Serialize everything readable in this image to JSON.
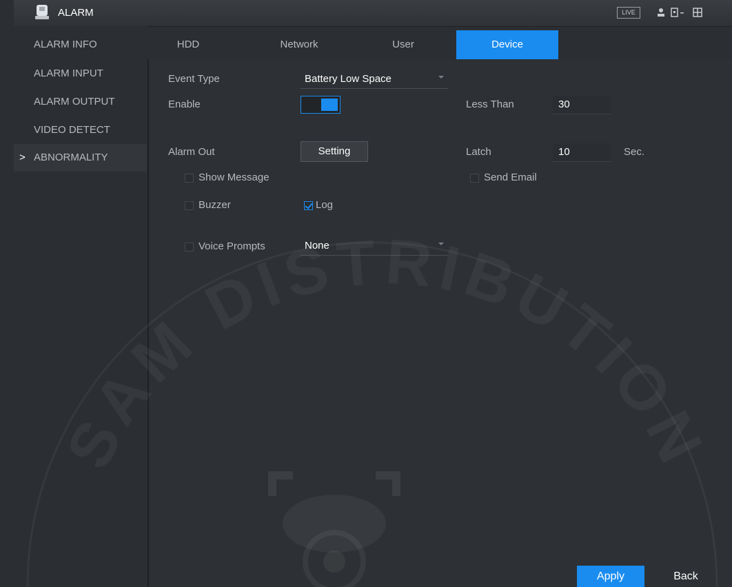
{
  "header": {
    "title": "ALARM",
    "live_badge": "LIVE"
  },
  "sidebar": {
    "items": [
      {
        "label": "ALARM INFO"
      },
      {
        "label": "ALARM INPUT"
      },
      {
        "label": "ALARM OUTPUT"
      },
      {
        "label": "VIDEO DETECT"
      },
      {
        "label": "ABNORMALITY",
        "chevron": ">"
      }
    ]
  },
  "tabs": [
    {
      "label": "HDD"
    },
    {
      "label": "Network"
    },
    {
      "label": "User"
    },
    {
      "label": "Device"
    }
  ],
  "form": {
    "event_type_label": "Event Type",
    "event_type_value": "Battery Low Space",
    "enable_label": "Enable",
    "less_than_label": "Less Than",
    "less_than_value": "30",
    "alarm_out_label": "Alarm Out",
    "setting_button": "Setting",
    "latch_label": "Latch",
    "latch_value": "10",
    "latch_unit": "Sec.",
    "show_message_label": "Show Message",
    "send_email_label": "Send Email",
    "buzzer_label": "Buzzer",
    "log_label": "Log",
    "voice_prompts_label": "Voice Prompts",
    "voice_prompts_value": "None"
  },
  "footer": {
    "apply_label": "Apply",
    "back_label": "Back"
  },
  "watermark": {
    "text": "SAM DISTRIBUTION"
  },
  "colors": {
    "accent": "#1a8cf0",
    "background": "#2b2e32"
  }
}
